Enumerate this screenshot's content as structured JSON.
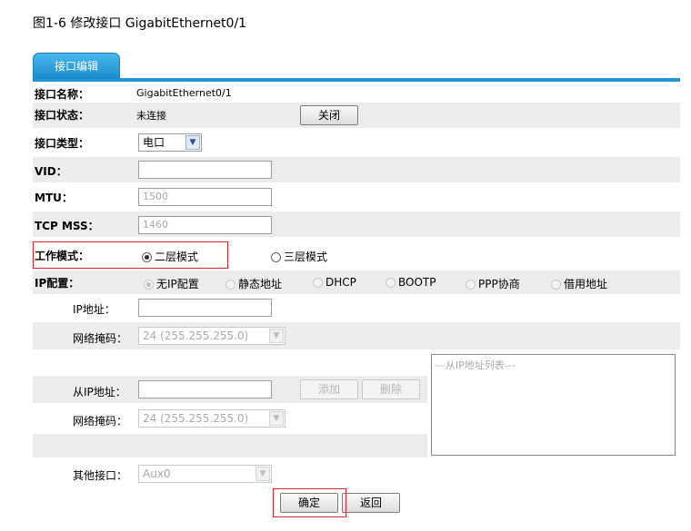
{
  "caption": "图1-6 修改接口 GigabitEthernet0/1",
  "tab": "接口编辑",
  "fields": {
    "name": {
      "label": "接口名称：",
      "value": "GigabitEthernet0/1"
    },
    "status": {
      "label": "接口状态：",
      "value": "未连接",
      "button": "关闭"
    },
    "type": {
      "label": "接口类型：",
      "selected": "电口"
    },
    "vid": {
      "label": "VID：",
      "value": ""
    },
    "mtu": {
      "label": "MTU：",
      "placeholder": "1500"
    },
    "tcpmss": {
      "label": "TCP MSS：",
      "placeholder": "1460"
    },
    "workmode": {
      "label": "工作模式：",
      "options": [
        "二层模式",
        "三层模式"
      ],
      "selected": "二层模式"
    },
    "ipconfig": {
      "label": "IP配置：",
      "options": [
        "无IP配置",
        "静态地址",
        "DHCP",
        "BOOTP",
        "PPP协商",
        "借用地址"
      ],
      "selected": "无IP配置"
    },
    "ipaddr": {
      "label": "IP地址：",
      "value": ""
    },
    "mask": {
      "label": "网络掩码：",
      "selected": "24 (255.255.255.0)"
    },
    "secondary_ip": {
      "label": "从IP地址：",
      "value": "",
      "add": "添加",
      "delete": "删除",
      "list_placeholder": "---从IP地址列表---"
    },
    "secondary_mask": {
      "label": "网络掩码：",
      "selected": "24 (255.255.255.0)"
    },
    "other_iface": {
      "label": "其他接口：",
      "selected": "Aux0"
    }
  },
  "buttons": {
    "ok": "确定",
    "back": "返回"
  },
  "colors": {
    "tab": "#1a8ccc",
    "highlight": "#e0212a",
    "shade": "#ececec"
  }
}
